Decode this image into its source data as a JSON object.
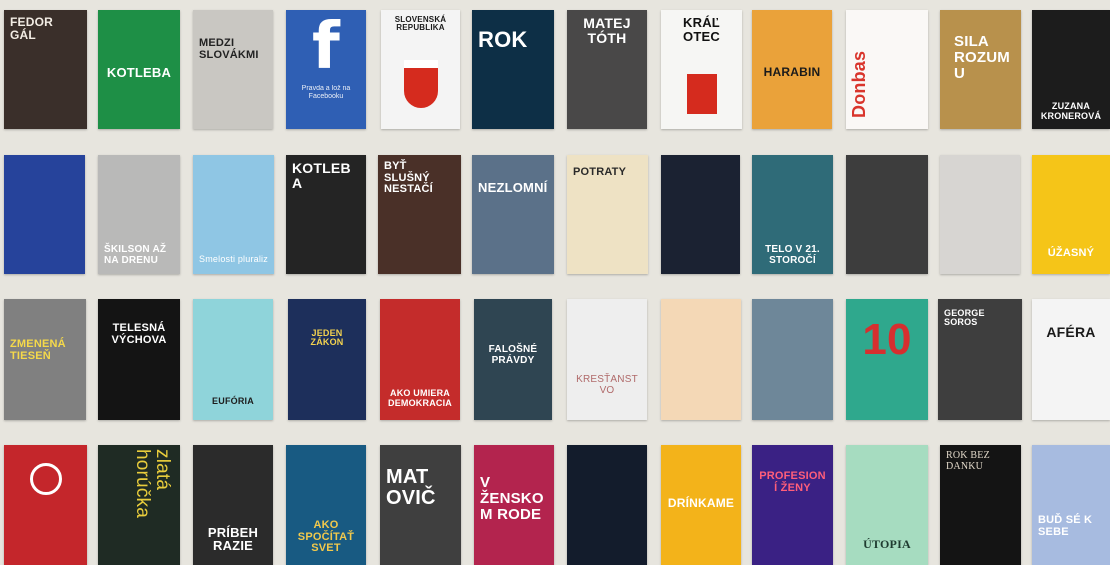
{
  "books": [
    {
      "title": "FEDOR GÁL",
      "subtitle": "",
      "author": "",
      "bg": "#3a2f2a",
      "fg": "#f2ece4"
    },
    {
      "title": "KOTLEBA",
      "subtitle": "",
      "author": "",
      "bg": "#1e8f46",
      "fg": "#ffffff"
    },
    {
      "title": "MEDZI SLOVÁKMI",
      "subtitle": "",
      "author": "",
      "bg": "#c9c7c2",
      "fg": "#222222"
    },
    {
      "title": "f",
      "subtitle": "Pravda a lož na Facebooku",
      "author": "",
      "bg": "#2f5fb4",
      "fg": "#ffffff"
    },
    {
      "title": "SLOVENSKÁ REPUBLIKA",
      "subtitle": "",
      "author": "",
      "bg": "#f4f4f4",
      "fg": "#1a1a1a"
    },
    {
      "title": "ROK",
      "subtitle": "",
      "author": "",
      "bg": "#0d2f46",
      "fg": "#ffffff"
    },
    {
      "title": "MATEJ TÓTH",
      "subtitle": "",
      "author": "",
      "bg": "#494848",
      "fg": "#ffffff"
    },
    {
      "title": "KRÁĽ OTEC",
      "subtitle": "",
      "author": "",
      "bg": "#f6f6f4",
      "fg": "#111111"
    },
    {
      "title": "HARABIN",
      "subtitle": "",
      "author": "",
      "bg": "#eaa23a",
      "fg": "#1b1b1b"
    },
    {
      "title": "Donbas",
      "subtitle": "",
      "author": "",
      "bg": "#faf8f6",
      "fg": "#d9352c"
    },
    {
      "title": "SILA ROZUMU",
      "subtitle": "",
      "author": "",
      "bg": "#b8914c",
      "fg": "#ffffff"
    },
    {
      "title": "ZUZANA KRONEROVÁ",
      "subtitle": "",
      "author": "",
      "bg": "#1c1c1c",
      "fg": "#ffffff"
    },
    {
      "title": "",
      "subtitle": "",
      "author": "",
      "bg": "#26439b",
      "fg": "#dfe6ff"
    },
    {
      "title": "ŠKILSON AŽ NA DRENU",
      "subtitle": "",
      "author": "",
      "bg": "#b9b9b8",
      "fg": "#ffffff"
    },
    {
      "title": "Smelosti pluraliz",
      "subtitle": "",
      "author": "",
      "bg": "#8fc6e4",
      "fg": "#ffffff"
    },
    {
      "title": "KOTLEBA",
      "subtitle": "",
      "author": "",
      "bg": "#242424",
      "fg": "#ffffff"
    },
    {
      "title": "BYŤ SLUŠNÝ NESTAČÍ",
      "subtitle": "",
      "author": "",
      "bg": "#4a3028",
      "fg": "#ffffff"
    },
    {
      "title": "NEZLOMNÍ",
      "subtitle": "",
      "author": "",
      "bg": "#5b7189",
      "fg": "#ffffff"
    },
    {
      "title": "POTRATY",
      "subtitle": "",
      "author": "",
      "bg": "#eee2c4",
      "fg": "#2a2a2a"
    },
    {
      "title": "",
      "subtitle": "",
      "author": "",
      "bg": "#1b2232",
      "fg": "#d9dde6"
    },
    {
      "title": "TELO V 21. STOROČÍ",
      "subtitle": "",
      "author": "",
      "bg": "#2f6b78",
      "fg": "#ffffff"
    },
    {
      "title": "",
      "subtitle": "",
      "author": "",
      "bg": "#3d3d3d",
      "fg": "#ffffff"
    },
    {
      "title": "",
      "subtitle": "",
      "author": "",
      "bg": "#d7d5d2",
      "fg": "#c0392b"
    },
    {
      "title": "ÚŽASNÝ",
      "subtitle": "",
      "author": "",
      "bg": "#f5c518",
      "fg": "#ffffff"
    },
    {
      "title": "ZMENENÁ TIESEŇ",
      "subtitle": "",
      "author": "",
      "bg": "#808080",
      "fg": "#f5d94a"
    },
    {
      "title": "TELESNÁ VÝCHOVA",
      "subtitle": "",
      "author": "",
      "bg": "#141414",
      "fg": "#ffffff"
    },
    {
      "title": "EUFÓRIA",
      "subtitle": "",
      "author": "",
      "bg": "#8fd4da",
      "fg": "#1d1d1d"
    },
    {
      "title": "JEDEN ZÁKON",
      "subtitle": "",
      "author": "",
      "bg": "#1d2f5b",
      "fg": "#f4d34f"
    },
    {
      "title": "AKO UMIERA DEMOKRACIA",
      "subtitle": "",
      "author": "",
      "bg": "#c42c2b",
      "fg": "#ffffff"
    },
    {
      "title": "FALOŠNÉ PRÁVDY",
      "subtitle": "",
      "author": "",
      "bg": "#2f4552",
      "fg": "#ffffff"
    },
    {
      "title": "KRESŤANSTVO",
      "subtitle": "",
      "author": "",
      "bg": "#eeeeee",
      "fg": "#b06a6a"
    },
    {
      "title": "",
      "subtitle": "",
      "author": "",
      "bg": "#f4d8b6",
      "fg": "#2d2d2d"
    },
    {
      "title": "",
      "subtitle": "",
      "author": "",
      "bg": "#6e8799",
      "fg": "#ffffff"
    },
    {
      "title": "10",
      "subtitle": "",
      "author": "",
      "bg": "#2fa88d",
      "fg": "#d62f2f"
    },
    {
      "title": "GEORGE SOROS",
      "subtitle": "",
      "author": "",
      "bg": "#3e3e3e",
      "fg": "#ffffff"
    },
    {
      "title": "AFÉRA",
      "subtitle": "",
      "author": "",
      "bg": "#f4f4f4",
      "fg": "#c42c2b"
    },
    {
      "title": "",
      "subtitle": "",
      "author": "",
      "bg": "#c4262b",
      "fg": "#ffffff"
    },
    {
      "title": "zlatá horúčka",
      "subtitle": "",
      "author": "",
      "bg": "#1f2b24",
      "fg": "#e9cd3c"
    },
    {
      "title": "PRÍBEH RAZIE",
      "subtitle": "",
      "author": "",
      "bg": "#2b2b2b",
      "fg": "#ffffff"
    },
    {
      "title": "AKO SPOČÍTAŤ SVET",
      "subtitle": "",
      "author": "",
      "bg": "#185a82",
      "fg": "#f2c94c"
    },
    {
      "title": "MATOVIČ",
      "subtitle": "",
      "author": "",
      "bg": "#3f3f3f",
      "fg": "#ffffff"
    },
    {
      "title": "V ŽENSKOM RODE",
      "subtitle": "",
      "author": "",
      "bg": "#b3244e",
      "fg": "#ffffff"
    },
    {
      "title": "",
      "subtitle": "",
      "author": "",
      "bg": "#131c2c",
      "fg": "#ffffff"
    },
    {
      "title": "DRÍNKAME",
      "subtitle": "",
      "author": "",
      "bg": "#f3b31a",
      "fg": "#ffffff"
    },
    {
      "title": "PROFESIONÍ ŽENY",
      "subtitle": "",
      "author": "",
      "bg": "#3a2184",
      "fg": "#ff5e7a"
    },
    {
      "title": "ÚTOPIA",
      "subtitle": "",
      "author": "",
      "bg": "#a6dcc0",
      "fg": "#1f3b30"
    },
    {
      "title": "ROK BEZ DANKU",
      "subtitle": "",
      "author": "",
      "bg": "#141414",
      "fg": "#e0d7c8"
    },
    {
      "title": "BUĎ SÉ K SEBE",
      "subtitle": "",
      "author": "",
      "bg": "#a7bbe0",
      "fg": "#ffffff"
    }
  ]
}
